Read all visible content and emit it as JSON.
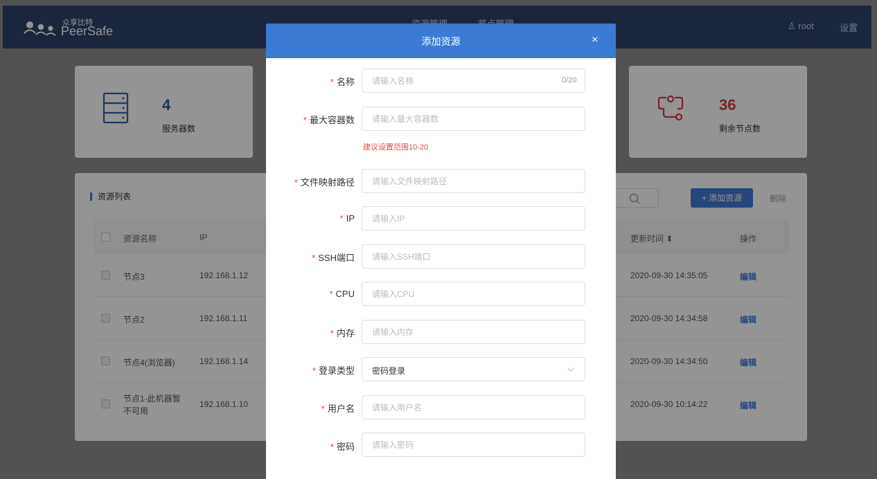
{
  "header": {
    "logo_cn": "众享比特",
    "logo_en": "PeerSafe",
    "nav": [
      "资源管理",
      "节点管理"
    ],
    "user": "root",
    "settings": "设置"
  },
  "stats": {
    "servers": {
      "value": "4",
      "label": "服务器数",
      "color": "#2f5fa8"
    },
    "nodes": {
      "value": "36",
      "label": "剩余节点数",
      "color": "#d23c3c"
    }
  },
  "list": {
    "title": "资源列表",
    "add_button": "+ 添加资源",
    "delete_button": "删除",
    "columns": [
      "资源名称",
      "IP",
      "更新时间 ⬍",
      "操作"
    ],
    "rows": [
      {
        "name": "节点3",
        "ip": "192.168.1.12",
        "updated": "2020-09-30 14:35:05",
        "action": "编辑"
      },
      {
        "name": "节点2",
        "ip": "192.168.1.11",
        "updated": "2020-09-30 14:34:58",
        "action": "编辑"
      },
      {
        "name": "节点4(浏览器)",
        "ip": "192.168.1.14",
        "updated": "2020-09-30 14:34:50",
        "action": "编辑"
      },
      {
        "name": "节点1-此机器暂\n不可用",
        "ip": "192.168.1.10",
        "updated": "2020-09-30 10:14:22",
        "action": "编辑"
      }
    ]
  },
  "modal": {
    "title": "添加资源",
    "close": "×",
    "name": {
      "label": "名称",
      "placeholder": "请输入名称",
      "value": "",
      "counter": "0/20"
    },
    "max_containers": {
      "label": "最大容器数",
      "placeholder": "请输入最大容器数",
      "value": "",
      "hint": "建议设置范围10-20"
    },
    "file_path": {
      "label": "文件映射路径",
      "placeholder": "请输入文件映射路径",
      "value": ""
    },
    "ip": {
      "label": "IP",
      "placeholder": "请输入IP",
      "value": ""
    },
    "ssh_port": {
      "label": "SSH端口",
      "placeholder": "请输入SSH端口",
      "value": ""
    },
    "cpu": {
      "label": "CPU",
      "placeholder": "请输入CPU",
      "value": ""
    },
    "memory": {
      "label": "内存",
      "placeholder": "请输入内存",
      "value": ""
    },
    "login_type": {
      "label": "登录类型",
      "value": "密码登录"
    },
    "username": {
      "label": "用户名",
      "placeholder": "请输入用户名",
      "value": ""
    },
    "password": {
      "label": "密码",
      "placeholder": "请输入密码",
      "value": ""
    }
  },
  "colors": {
    "header_bg": "#2e4366",
    "modal_header": "#3b7bd5",
    "required": "#e04848",
    "accent": "#3d7ad6"
  }
}
